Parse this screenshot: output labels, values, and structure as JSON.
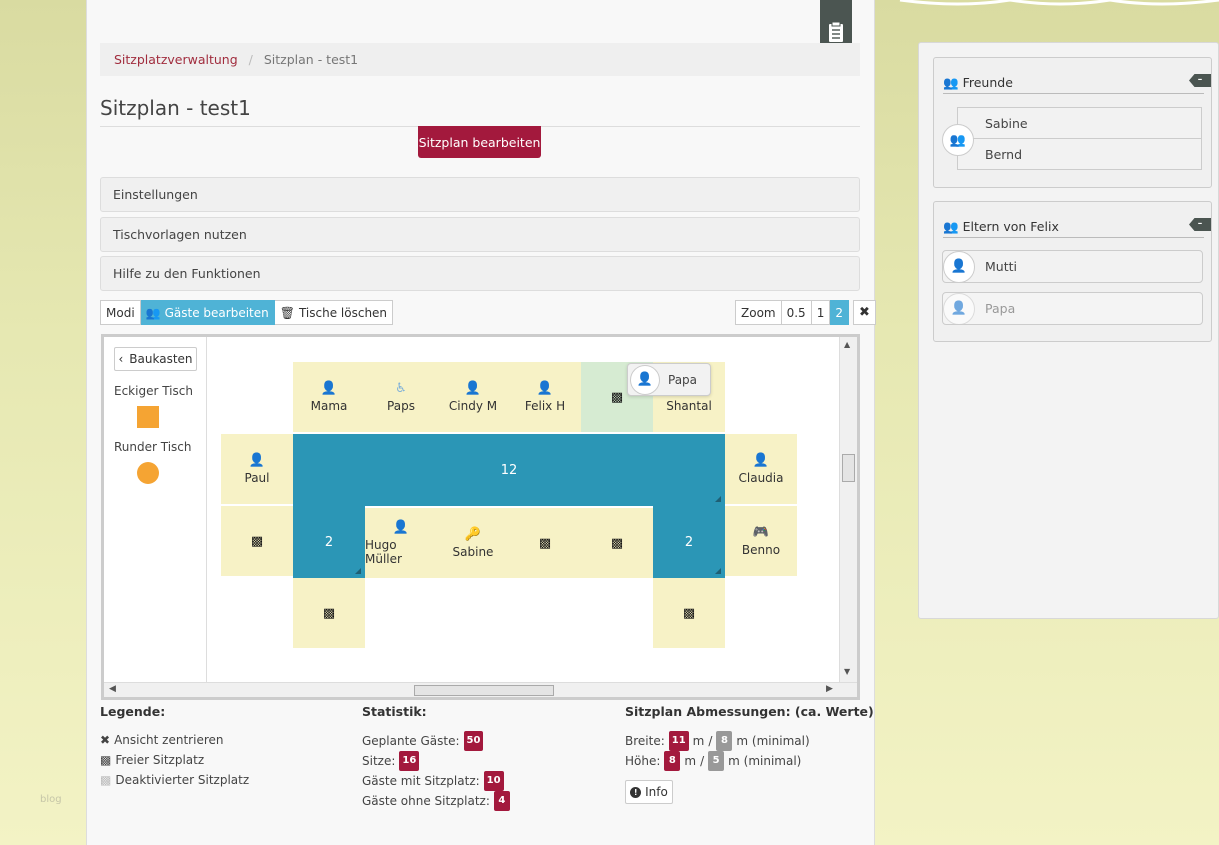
{
  "branding": {
    "watermark": "blog"
  },
  "breadcrumb": {
    "root": "Sitzplatzverwaltung",
    "separator": "/",
    "current": "Sitzplan - test1"
  },
  "page_title": "Sitzplan - test1",
  "edit_button": "Sitzplan bearbeiten",
  "accordions": [
    "Einstellungen",
    "Tischvorlagen nutzen",
    "Hilfe zu den Funktionen"
  ],
  "toolbar": {
    "modes": "Modi",
    "edit_guests": "Gäste bearbeiten",
    "delete_tables": "Tische löschen",
    "zoom_label": "Zoom",
    "zoom_options": [
      "0.5",
      "1",
      "2"
    ],
    "zoom_selected": "2"
  },
  "toolbox": {
    "back": "Baukasten",
    "square_table": "Eckiger Tisch",
    "round_table": "Runder Tisch",
    "shape_color": "#f5a433"
  },
  "plan": {
    "tables": {
      "main": "12",
      "left_leg": "2",
      "right_leg": "2"
    },
    "seats": {
      "top_1": {
        "name": "Mama",
        "icon": "person-red-icon"
      },
      "top_2": {
        "name": "Paps",
        "icon": "wheelchair-icon"
      },
      "top_3": {
        "name": "Cindy M",
        "icon": "person-female-icon"
      },
      "top_4": {
        "name": "Felix H",
        "icon": "person-icon"
      },
      "top_5": {
        "name": "",
        "icon": "chair-icon"
      },
      "top_6": {
        "name": "Shantal",
        "icon": ""
      },
      "left_1": {
        "name": "Paul",
        "icon": "person-blue-icon"
      },
      "left_2": {
        "name": "",
        "icon": "chair-icon"
      },
      "right_1": {
        "name": "Claudia",
        "icon": "person-red-icon"
      },
      "right_2": {
        "name": "Benno",
        "icon": "gamepad-icon"
      },
      "inner_1": {
        "name": "Hugo Müller",
        "icon": "person-icon"
      },
      "inner_2": {
        "name": "Sabine",
        "icon": "key-icon"
      },
      "inner_3": {
        "name": "",
        "icon": "chair-icon"
      },
      "inner_4": {
        "name": "",
        "icon": "chair-icon"
      },
      "bottom_left": {
        "name": "",
        "icon": "chair-icon"
      },
      "bottom_right": {
        "name": "",
        "icon": "chair-icon"
      }
    },
    "dragging_chip": "Papa",
    "table_color": "#2b96b6",
    "seat_color": "#f7f2c6"
  },
  "legend": {
    "title": "Legende:",
    "items": [
      "Ansicht zentrieren",
      "Freier Sitzplatz",
      "Deaktivierter Sitzplatz"
    ]
  },
  "stats": {
    "title": "Statistik:",
    "rows": [
      {
        "label": "Geplante Gäste:",
        "value": "50"
      },
      {
        "label": "Sitze:",
        "value": "16"
      },
      {
        "label": "Gäste mit Sitzplatz:",
        "value": "10"
      },
      {
        "label": "Gäste ohne Sitzplatz:",
        "value": "4"
      }
    ]
  },
  "dimensions": {
    "title": "Sitzplan Abmessungen: (ca. Werte)",
    "width_label": "Breite:",
    "width_value": "11",
    "width_min": "8",
    "height_label": "Höhe:",
    "height_value": "8",
    "height_min": "5",
    "unit": "m",
    "slash": "/",
    "min_suffix": "m (minimal)",
    "info_button": "Info"
  },
  "groups": [
    {
      "title": "Freunde",
      "members": [
        "Sabine",
        "Bernd"
      ]
    },
    {
      "title": "Eltern von Felix",
      "members": [
        "Mutti",
        "Papa"
      ]
    }
  ],
  "colors": {
    "accent": "#a3193d",
    "active": "#4fb3d6"
  }
}
